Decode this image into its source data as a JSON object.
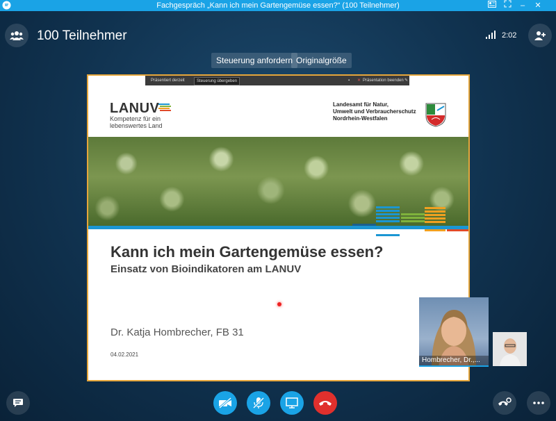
{
  "window": {
    "title": "Fachgespräch „Kann ich mein Gartengemüse essen?“ (100 Teilnehmer)",
    "controls": {
      "minimize": "–",
      "close": "✕"
    }
  },
  "header": {
    "participants_label": "100 Teilnehmer",
    "call_time": "2:02"
  },
  "actions": {
    "request_control": "Steuerung anfordern",
    "original_size": "Originalgröße"
  },
  "share_toolbar": {
    "presenting": "Präsentiert derzeit",
    "give_control": "Steuerung übergeben",
    "stop_presenting": "Präsentation beenden"
  },
  "slide": {
    "logo": "LANUV",
    "logo_tagline": "Kompetenz für ein lebenswertes Land",
    "agency_line1": "Landesamt für Natur,",
    "agency_line2": "Umwelt und Verbraucherschutz",
    "agency_line3": "Nordrhein-Westfalen",
    "title": "Kann ich mein Gartengemüse essen?",
    "subtitle": "Einsatz von Bioindikatoren am LANUV",
    "author": "Dr. Katja Hombrecher, FB 31",
    "date": "04.02.2021"
  },
  "videos": {
    "presenter_name": "Hombrecher, Dr.,..."
  },
  "colors": {
    "accent": "#1aa3e6",
    "hangup": "#e0302d",
    "screen_border": "#e6a63a",
    "slide_blue": "#1b96d3"
  }
}
